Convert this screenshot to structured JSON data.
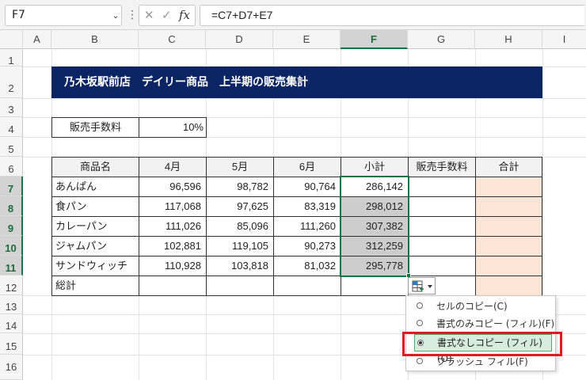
{
  "formula_bar": {
    "name_box": "F7",
    "dots": "⋮",
    "cancel": "✕",
    "enter": "✓",
    "fx": "fx",
    "formula": "=C7+D7+E7"
  },
  "columns": [
    "A",
    "B",
    "C",
    "D",
    "E",
    "F",
    "G",
    "H",
    "I"
  ],
  "rows": [
    "1",
    "2",
    "3",
    "4",
    "5",
    "6",
    "7",
    "8",
    "9",
    "10",
    "11",
    "12",
    "13",
    "14",
    "15",
    "16"
  ],
  "sheet": {
    "title": "乃木坂駅前店　デイリー商品　上半期の販売集計",
    "fee_label": "販売手数料",
    "fee_rate": "10%",
    "headers": [
      "商品名",
      "4月",
      "5月",
      "6月",
      "小計",
      "販売手数料",
      "合計"
    ],
    "data_rows": [
      {
        "name": "あんぱん",
        "apr": "96,596",
        "may": "98,782",
        "jun": "90,764",
        "subtotal": "286,142"
      },
      {
        "name": "食パン",
        "apr": "117,068",
        "may": "97,625",
        "jun": "83,319",
        "subtotal": "298,012"
      },
      {
        "name": "カレーパン",
        "apr": "111,026",
        "may": "85,096",
        "jun": "111,260",
        "subtotal": "307,382"
      },
      {
        "name": "ジャムパン",
        "apr": "102,881",
        "may": "119,105",
        "jun": "90,273",
        "subtotal": "312,259"
      },
      {
        "name": "サンドウィッチ",
        "apr": "110,928",
        "may": "103,818",
        "jun": "81,032",
        "subtotal": "295,778"
      }
    ],
    "total_label": "総計"
  },
  "autofill_menu": {
    "options": [
      {
        "label": "セルのコピー(C)",
        "selected": false
      },
      {
        "label": "書式のみコピー (フィル)(F)",
        "selected": false
      },
      {
        "label": "書式なしコピー (フィル)(O)",
        "selected": true
      },
      {
        "label": "フラッシュ フィル(F)",
        "selected": false
      }
    ]
  },
  "colors": {
    "title_bg": "#0b2463",
    "selection_gray": "#d0d0d0",
    "total_fill": "#fde5d6",
    "excel_green": "#1e7145",
    "highlight_red": "#e0191e"
  }
}
